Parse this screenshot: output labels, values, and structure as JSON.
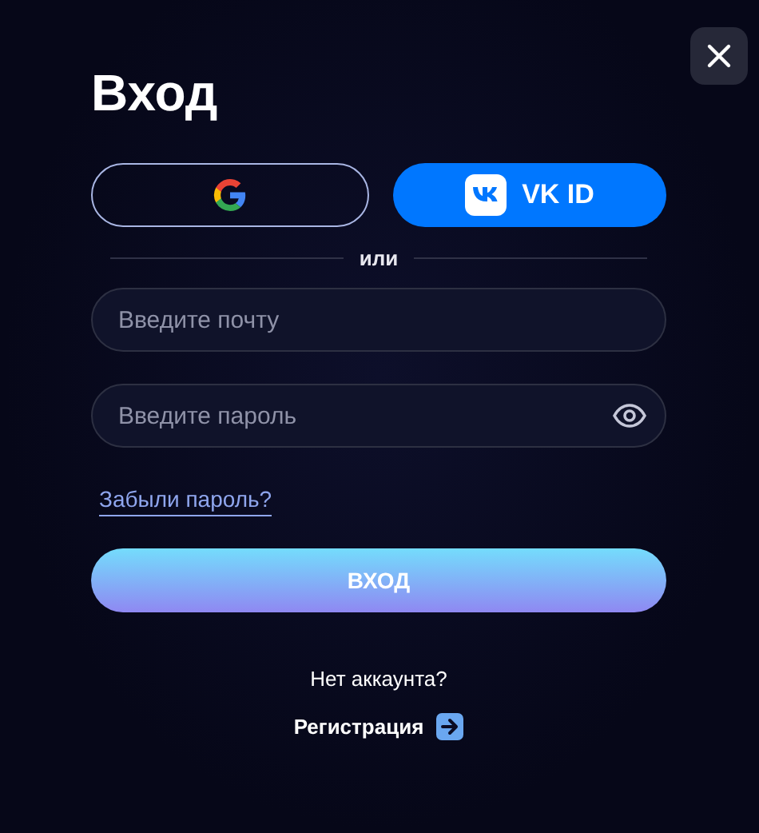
{
  "title": "Вход",
  "social_buttons": [
    {
      "kind": "google"
    },
    {
      "kind": "vk",
      "label": "VK ID"
    }
  ],
  "divider": "или",
  "fields": [
    {
      "placeholder": "Введите почту",
      "kind": "email"
    },
    {
      "placeholder": "Введите пароль",
      "kind": "password"
    }
  ],
  "forgot_link": "Забыли пароль?",
  "submit": "ВХОД",
  "no_account": "Нет аккаунта?",
  "register_link": "Регистрация"
}
